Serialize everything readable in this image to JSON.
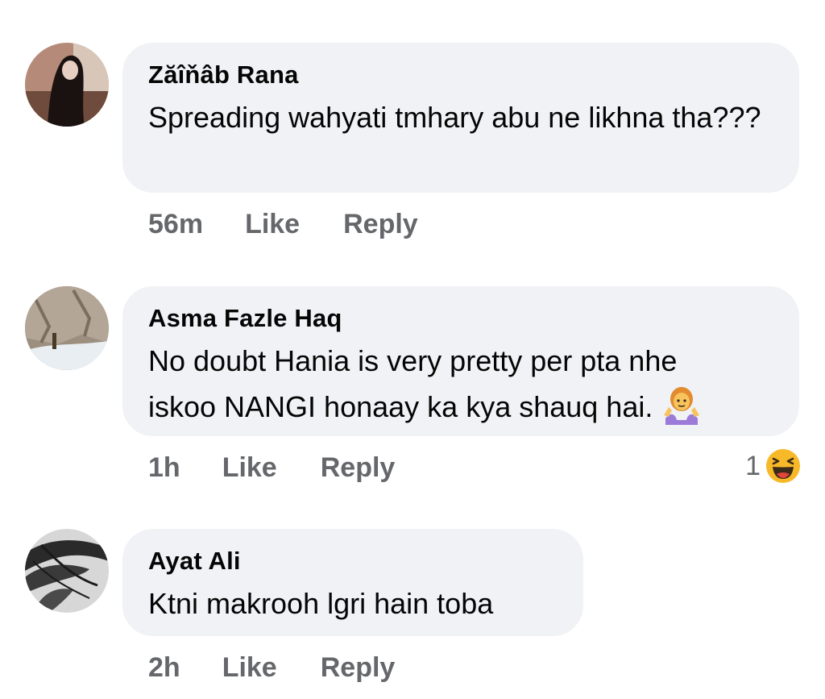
{
  "comments": [
    {
      "author": "Zăîňâb Rana",
      "text": "Spreading wahyati tmhary abu ne likhna tha???",
      "time": "56m",
      "like": "Like",
      "reply": "Reply"
    },
    {
      "author": "Asma Fazle Haq",
      "text_line1": "No doubt Hania is very pretty per pta nhe",
      "text_line2": "iskoo NANGI honaay ka kya shauq hai.",
      "inline_emoji": "woman-shrugging-icon",
      "time": "1h",
      "like": "Like",
      "reply": "Reply",
      "reaction_count": "1",
      "reaction_icon": "laughing-face-icon"
    },
    {
      "author": "Ayat Ali",
      "text": "Ktni makrooh lgri hain toba",
      "time": "2h",
      "like": "Like",
      "reply": "Reply"
    }
  ],
  "colors": {
    "bubble": "#f0f2f5",
    "meta_text": "#65676b",
    "body_text": "#050505"
  }
}
